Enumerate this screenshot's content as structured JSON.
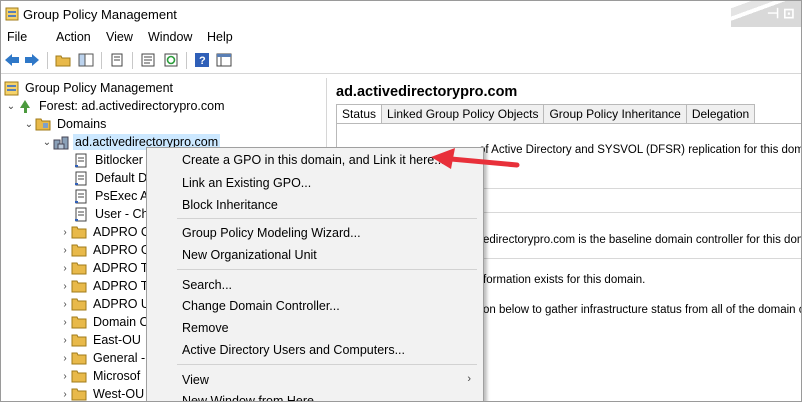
{
  "window": {
    "title": "Group Policy Management",
    "icon": "gpmc-icon"
  },
  "menu": [
    "File",
    "Action",
    "View",
    "Window",
    "Help"
  ],
  "toolbar": {
    "buttons": [
      "back-arrow-icon",
      "forward-arrow-icon",
      "up-folder-icon",
      "show-hide-tree-icon",
      "copy-icon",
      "properties-icon",
      "refresh-icon",
      "help-icon",
      "export-list-icon"
    ]
  },
  "tree": {
    "root": "Group Policy Management",
    "forest": "Forest: ad.activedirectorypro.com",
    "domains": "Domains",
    "domain": "ad.activedirectorypro.com",
    "gpo_links": [
      "Bitlocker",
      "Default D",
      "PsExec Al",
      "User - Ch"
    ],
    "ous": [
      "ADPRO C",
      "ADPRO G",
      "ADPRO Te",
      "ADPRO Te",
      "ADPRO U",
      "Domain C",
      "East-OU",
      "General -",
      "Microsof",
      "West-OU"
    ]
  },
  "right_pane": {
    "title": "ad.activedirectorypro.com",
    "tabs": [
      "Status",
      "Linked Group Policy Objects",
      "Group Policy Inheritance",
      "Delegation"
    ],
    "active_tab": "Status",
    "lines": [
      "of Active Directory and SYSVOL (DFSR) replication for this domain a",
      "edirectorypro.com is the baseline domain controller for this domain.",
      "formation exists for this domain.",
      "on below to gather infrastructure status from all of the domain controll"
    ]
  },
  "context_menu": {
    "items": [
      "Create a GPO in this domain, and Link it here...",
      "Link an Existing GPO...",
      "Block Inheritance",
      "Group Policy Modeling Wizard...",
      "New Organizational Unit",
      "Search...",
      "Change Domain Controller...",
      "Remove",
      "Active Directory Users and Computers...",
      "View",
      "New Window from Here"
    ],
    "submenu_arrow": "›"
  },
  "colors": {
    "selection": "#cce8ff",
    "annotation_arrow": "#e8303a",
    "folder": "#e8b94a"
  }
}
